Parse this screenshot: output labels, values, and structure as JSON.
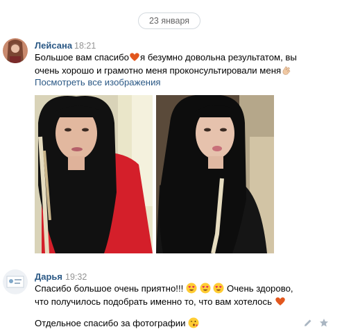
{
  "date_separator": "23 января",
  "messages": [
    {
      "author": "Лейсана",
      "time": "18:21",
      "line1_a": "Большое вам спасибо",
      "line1_b": "я безумно довольна результатом, вы",
      "line2": "очень хорошо и грамотно меня проконсультировали меня",
      "view_all_images": "Посмотреть все изображения",
      "images": [
        {
          "icon": "photo-red-sweater"
        },
        {
          "icon": "photo-black-blouse"
        }
      ]
    },
    {
      "author": "Дарья",
      "time": "19:32",
      "line1_a": "Спасибо большое очень приятно!!!",
      "line1_b": "Очень здорово,",
      "line2": "что получилось подобрать именно то, что вам хотелось",
      "line3": "Отдельное спасибо за фотографии"
    }
  ],
  "actions": {
    "edit_icon": "pencil-icon",
    "favorite_icon": "star-icon"
  },
  "colors": {
    "link": "#2a5885",
    "time": "#939393",
    "heart": "#e2571e",
    "separator_border": "#d3d9de"
  }
}
